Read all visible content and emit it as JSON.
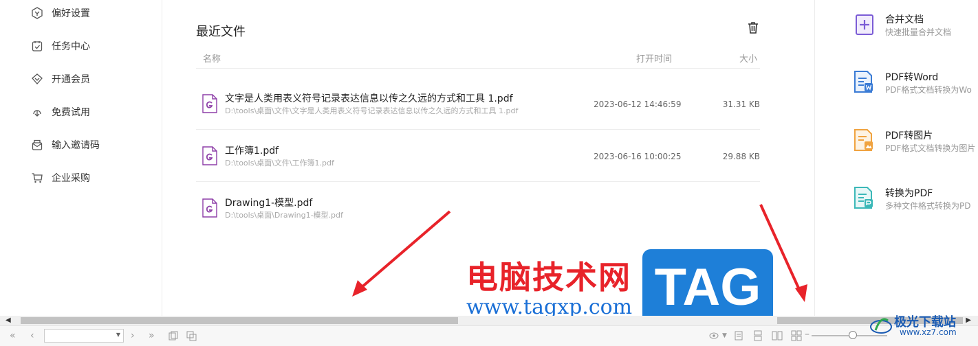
{
  "sidebar": {
    "items": [
      {
        "label": "偏好设置",
        "icon": "preferences-icon"
      },
      {
        "label": "任务中心",
        "icon": "task-center-icon"
      },
      {
        "label": "开通会员",
        "icon": "membership-icon"
      },
      {
        "label": "免费试用",
        "icon": "free-trial-icon"
      },
      {
        "label": "输入邀请码",
        "icon": "invite-code-icon"
      },
      {
        "label": "企业采购",
        "icon": "enterprise-cart-icon"
      }
    ]
  },
  "recent": {
    "title": "最近文件",
    "headers": {
      "name": "名称",
      "time": "打开时间",
      "size": "大小"
    },
    "files": [
      {
        "name": "文字是人类用表义符号记录表达信息以传之久远的方式和工具 1.pdf",
        "path": "D:\\tools\\桌面\\文件\\文字是人类用表义符号记录表达信息以传之久远的方式和工具 1.pdf",
        "time": "2023-06-12 14:46:59",
        "size": "31.31 KB"
      },
      {
        "name": "工作簿1.pdf",
        "path": "D:\\tools\\桌面\\文件\\工作簿1.pdf",
        "time": "2023-06-16 10:00:25",
        "size": "29.88 KB"
      },
      {
        "name": "Drawing1-模型.pdf",
        "path": "D:\\tools\\桌面\\Drawing1-模型.pdf",
        "time": "",
        "size": ""
      }
    ]
  },
  "tools": [
    {
      "name": "合并文档",
      "desc": "快速批量合并文档",
      "color": "#7b5cd6"
    },
    {
      "name": "PDF转Word",
      "desc": "PDF格式文档转换为Wo",
      "color": "#3a7bd5"
    },
    {
      "name": "PDF转图片",
      "desc": "PDF格式文档转换为图片",
      "color": "#f0a340"
    },
    {
      "name": "转换为PDF",
      "desc": "多种文件格式转换为PD",
      "color": "#3bb8b8"
    }
  ],
  "watermark": {
    "cn": "电脑技术网",
    "url": "www.tagxp.com",
    "tag": "TAG",
    "logo_cn": "极光下载站",
    "logo_url": "www.xz7.com"
  },
  "colors": {
    "accent": "#7b5cd6",
    "pdf_icon": "#8e3fa8",
    "arrow": "#e8232a"
  }
}
